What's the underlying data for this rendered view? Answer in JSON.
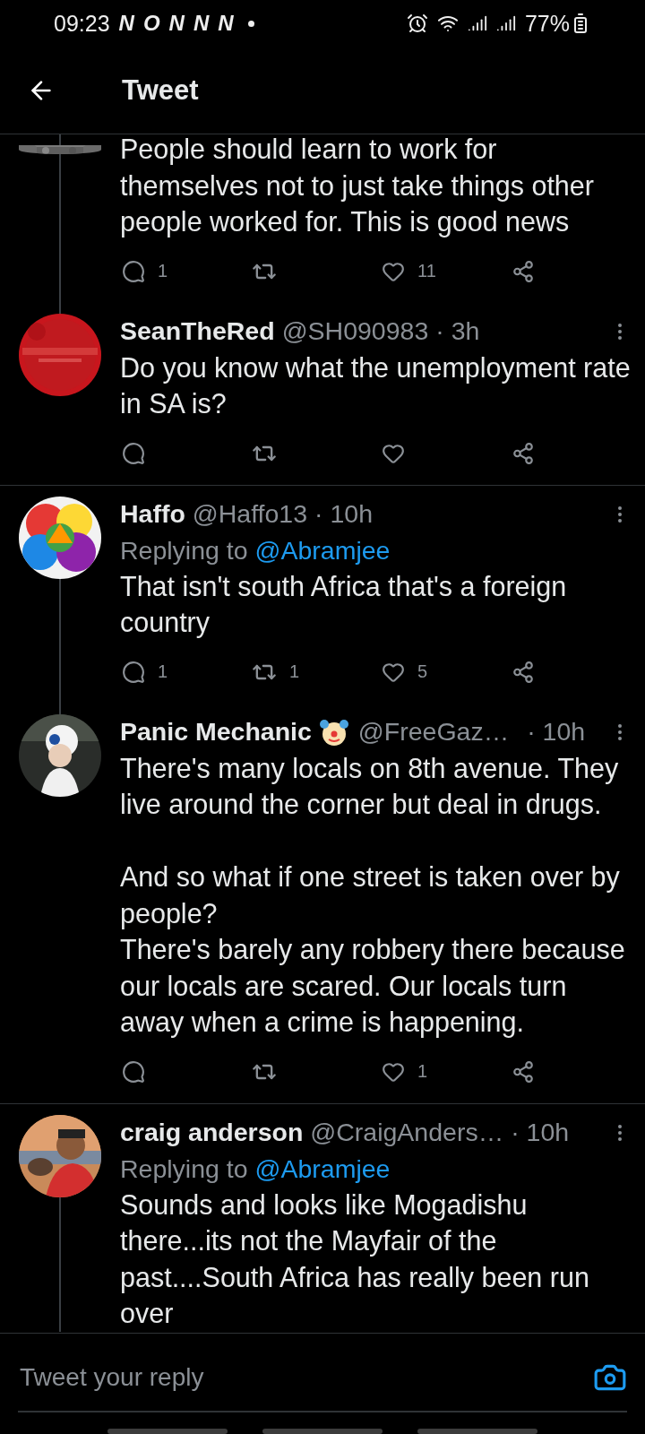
{
  "status_bar": {
    "time": "09:23",
    "notification_icons": [
      "N",
      "O",
      "N",
      "N",
      "N"
    ],
    "battery": "77%"
  },
  "header": {
    "title": "Tweet"
  },
  "tweets": [
    {
      "kind": "continued",
      "text": "People should learn to work for themselves not to just take things other people worked for. This is good news",
      "actions_visible": true,
      "actions": {
        "reply_count": "1",
        "like_count": "11"
      },
      "thread_above": true,
      "thread_below": true,
      "divider_below": false
    },
    {
      "kind": "full",
      "name": "SeanTheRed",
      "handle": "@SH090983",
      "time": "· 3h",
      "text": "Do you know what the unemployment rate in SA is?",
      "actions_visible": true,
      "thread_above": true,
      "thread_below": false,
      "divider_below": true
    },
    {
      "kind": "full",
      "name": "Haffo",
      "handle": "@Haffo13",
      "time": "· 10h",
      "replying_label": "Replying to",
      "replying_to": "@Abramjee",
      "text": "That isn't south Africa that's a foreign country",
      "actions_visible": true,
      "actions": {
        "reply_count": "1",
        "retweet_count": "1",
        "like_count": "5"
      },
      "thread_above": false,
      "thread_below": true,
      "divider_below": false
    },
    {
      "kind": "full",
      "name": "Panic Mechanic",
      "emoji": true,
      "handle": "@FreeGaz…",
      "time": "· 10h",
      "text": "There's many locals on 8th avenue. They live around the corner but deal in drugs.\n\nAnd so what if one street is taken over by people?\nThere's barely any robbery there because our locals are scared. Our locals turn away when a crime is happening.",
      "actions_visible": true,
      "actions": {
        "like_count": "1"
      },
      "thread_above": true,
      "thread_below": false,
      "divider_below": true
    },
    {
      "kind": "full",
      "name": "craig anderson",
      "handle": "@CraigAnders…",
      "time": "· 10h",
      "replying_label": "Replying to",
      "replying_to": "@Abramjee",
      "text": "Sounds and looks like Mogadishu there...its not the Mayfair of the past....South Africa has really been run over",
      "actions_visible": false,
      "thread_above": false,
      "thread_below": true,
      "divider_below": false
    }
  ],
  "composer": {
    "placeholder": "Tweet your reply"
  }
}
